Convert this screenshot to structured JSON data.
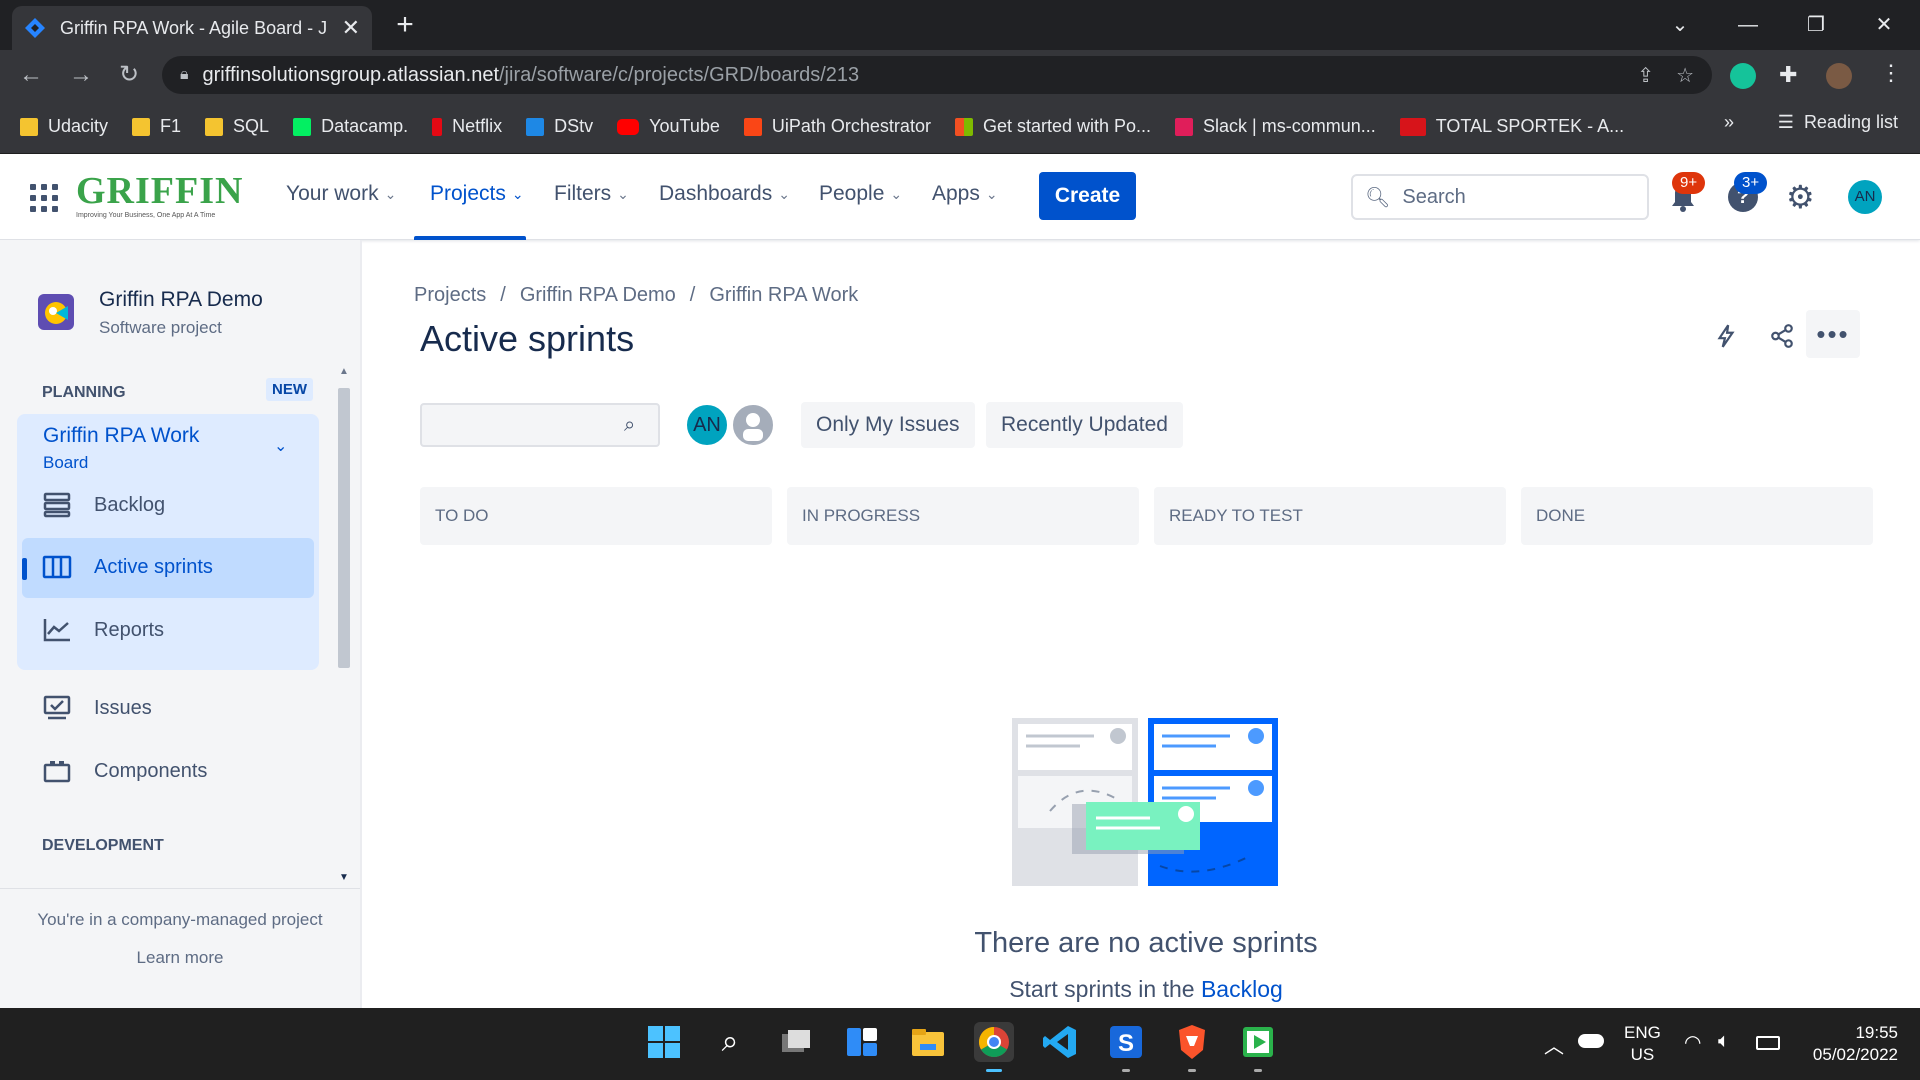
{
  "browser": {
    "tab_title": "Griffin RPA Work - Agile Board - J",
    "url_host": "griffinsolutionsgroup.atlassian.net",
    "url_path": "/jira/software/c/projects/GRD/boards/213",
    "bookmarks": [
      {
        "label": "Udacity",
        "color": "#f4c430"
      },
      {
        "label": "F1",
        "color": "#f4c430"
      },
      {
        "label": "SQL",
        "color": "#f4c430"
      },
      {
        "label": "Datacamp.",
        "color": "#03ef62"
      },
      {
        "label": "Netflix",
        "color": "#e50914"
      },
      {
        "label": "DStv",
        "color": "#1e88e5"
      },
      {
        "label": "YouTube",
        "color": "#ff0000"
      },
      {
        "label": "UiPath Orchestrator",
        "color": "#fa4616"
      },
      {
        "label": "Get started with Po...",
        "color": "#f25022"
      },
      {
        "label": "Slack | ms-commun...",
        "color": "#e01e5a"
      },
      {
        "label": "TOTAL SPORTEK - A...",
        "color": "#d7141a"
      }
    ],
    "overflow": "»",
    "reading_list": "Reading list"
  },
  "jira_nav": {
    "logo": "GRIFFIN",
    "logo_tagline": "Improving Your Business, One App At A Time",
    "items": [
      {
        "label": "Your work"
      },
      {
        "label": "Projects"
      },
      {
        "label": "Filters"
      },
      {
        "label": "Dashboards"
      },
      {
        "label": "People"
      },
      {
        "label": "Apps"
      }
    ],
    "create": "Create",
    "search_placeholder": "Search",
    "notifications_badge": "9+",
    "help_badge": "3+",
    "avatar": "AN"
  },
  "sidebar": {
    "project_name": "Griffin RPA Demo",
    "project_type": "Software project",
    "planning": "PLANNING",
    "new_badge": "NEW",
    "board_name": "Griffin RPA Work",
    "board_sub": "Board",
    "items": [
      {
        "label": "Backlog"
      },
      {
        "label": "Active sprints"
      },
      {
        "label": "Reports"
      },
      {
        "label": "Issues"
      },
      {
        "label": "Components"
      }
    ],
    "development": "DEVELOPMENT",
    "company_note": "You're in a company-managed project",
    "learn_more": "Learn more"
  },
  "main": {
    "breadcrumb": [
      "Projects",
      "Griffin RPA Demo",
      "Griffin RPA Work"
    ],
    "title": "Active sprints",
    "avatar": "AN",
    "filters": [
      "Only My Issues",
      "Recently Updated"
    ],
    "columns": [
      "TO DO",
      "IN PROGRESS",
      "READY TO TEST",
      "DONE"
    ],
    "empty_title": "There are no active sprints",
    "empty_sub_prefix": "Start sprints in the",
    "empty_sub_link": "Backlog"
  },
  "taskbar": {
    "lang1": "ENG",
    "lang2": "US",
    "time": "19:55",
    "date": "05/02/2022"
  }
}
